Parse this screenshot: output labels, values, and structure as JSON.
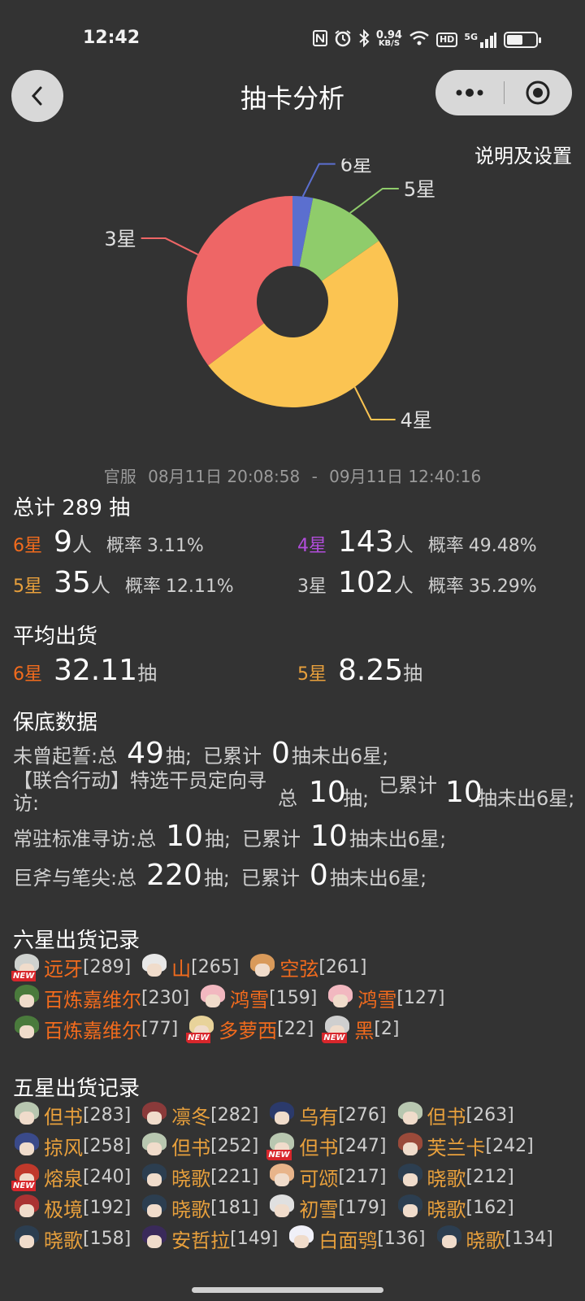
{
  "status": {
    "time": "12:42",
    "speed_value": "0.94",
    "speed_unit": "KB/S",
    "hd": "HD",
    "network": "5G",
    "battery_level": 0.55
  },
  "nav": {
    "title": "抽卡分析",
    "help": "说明及设置"
  },
  "colors": {
    "star6": "#5b6fcf",
    "star5": "#8fcc6b",
    "star4": "#fbc452",
    "star3": "#ee6666"
  },
  "chart_data": {
    "type": "pie",
    "donut": true,
    "categories": [
      "6星",
      "5星",
      "4星",
      "3星"
    ],
    "values": [
      9,
      35,
      143,
      102
    ]
  },
  "summary": {
    "date_server": "官服",
    "date_start": "08月11日 20:08:58",
    "date_sep": "-",
    "date_end": "09月11日 12:40:16",
    "total_prefix": "总计",
    "total_count": "289",
    "total_unit": "抽",
    "person_unit": "人",
    "prob_label": "概率",
    "rows": [
      {
        "star": "6星",
        "count": "9",
        "prob": "3.11%"
      },
      {
        "star": "4星",
        "count": "143",
        "prob": "49.48%"
      },
      {
        "star": "5星",
        "count": "35",
        "prob": "12.11%"
      },
      {
        "star": "3星",
        "count": "102",
        "prob": "35.29%"
      }
    ]
  },
  "average": {
    "title": "平均出货",
    "unit": "抽",
    "six_label": "6星",
    "six_value": "32.11",
    "five_label": "5星",
    "five_value": "8.25"
  },
  "pity": {
    "title": "保底数据",
    "pull_unit": "抽;",
    "accum_label": "已累计",
    "not_yet": "抽未出6星;",
    "rows": [
      {
        "name": "未曾起誓:总",
        "total": "49",
        "accum": "0"
      },
      {
        "name": "常驻标准寻访:总",
        "total": "10",
        "accum": "10"
      },
      {
        "name": "巨斧与笔尖:总",
        "total": "220",
        "accum": "0"
      }
    ],
    "special": {
      "name": "【联合行动】特选干员定向寻访:",
      "total_label": "总",
      "total": "10",
      "accum_label": "已累计",
      "accum": "10",
      "tail": "抽未出6星;"
    }
  },
  "six_records": {
    "title": "六星出货记录",
    "new_tag": "NEW",
    "rows": [
      [
        {
          "name": "远牙",
          "pull": "[289]",
          "new": true,
          "hair": "#cfd2cf"
        },
        {
          "name": "山",
          "pull": "[265]",
          "new": false,
          "hair": "#e8e8e8"
        },
        {
          "name": "空弦",
          "pull": "[261]",
          "new": false,
          "hair": "#d99a5a"
        }
      ],
      [
        {
          "name": "百炼嘉维尔",
          "pull": "[230]",
          "new": false,
          "hair": "#4a7a3c"
        },
        {
          "name": "鸿雪",
          "pull": "[159]",
          "new": false,
          "hair": "#f2b8c0"
        },
        {
          "name": "鸿雪",
          "pull": "[127]",
          "new": false,
          "hair": "#f2b8c0"
        }
      ],
      [
        {
          "name": "百炼嘉维尔",
          "pull": "[77]",
          "new": false,
          "hair": "#4a7a3c"
        },
        {
          "name": "多萝西",
          "pull": "[22]",
          "new": true,
          "hair": "#e8d39a"
        },
        {
          "name": "黑",
          "pull": "[2]",
          "new": true,
          "hair": "#cfcfcf"
        }
      ]
    ]
  },
  "five_records": {
    "title": "五星出货记录",
    "new_tag": "NEW",
    "rows": [
      [
        {
          "name": "但书",
          "pull": "[283]",
          "new": false,
          "hair": "#b8c7b0"
        },
        {
          "name": "凛冬",
          "pull": "[282]",
          "new": false,
          "hair": "#8a3a3a"
        },
        {
          "name": "乌有",
          "pull": "[276]",
          "new": false,
          "hair": "#2b3a6b"
        },
        {
          "name": "但书",
          "pull": "[263]",
          "new": false,
          "hair": "#b8c7b0"
        }
      ],
      [
        {
          "name": "掠风",
          "pull": "[258]",
          "new": false,
          "hair": "#3a4a8a"
        },
        {
          "name": "但书",
          "pull": "[252]",
          "new": false,
          "hair": "#b8c7b0"
        },
        {
          "name": "但书",
          "pull": "[247]",
          "new": true,
          "hair": "#b8c7b0"
        },
        {
          "name": "芙兰卡",
          "pull": "[242]",
          "new": false,
          "hair": "#9a4a3a"
        }
      ],
      [
        {
          "name": "熔泉",
          "pull": "[240]",
          "new": true,
          "hair": "#c0392b"
        },
        {
          "name": "晓歌",
          "pull": "[221]",
          "new": false,
          "hair": "#2c3e50"
        },
        {
          "name": "可颂",
          "pull": "[217]",
          "new": false,
          "hair": "#e8b48a"
        },
        {
          "name": "晓歌",
          "pull": "[212]",
          "new": false,
          "hair": "#2c3e50"
        }
      ],
      [
        {
          "name": "极境",
          "pull": "[192]",
          "new": false,
          "hair": "#a33"
        },
        {
          "name": "晓歌",
          "pull": "[181]",
          "new": false,
          "hair": "#2c3e50"
        },
        {
          "name": "初雪",
          "pull": "[179]",
          "new": false,
          "hair": "#e0e0e0"
        },
        {
          "name": "晓歌",
          "pull": "[162]",
          "new": false,
          "hair": "#2c3e50"
        }
      ],
      [
        {
          "name": "晓歌",
          "pull": "[158]",
          "new": false,
          "hair": "#2c3e50"
        },
        {
          "name": "安哲拉",
          "pull": "[149]",
          "new": false,
          "hair": "#3a2a5a"
        },
        {
          "name": "白面鸮",
          "pull": "[136]",
          "new": false,
          "hair": "#f0f0f8"
        },
        {
          "name": "晓歌",
          "pull": "[134]",
          "new": false,
          "hair": "#2c3e50"
        }
      ]
    ]
  }
}
